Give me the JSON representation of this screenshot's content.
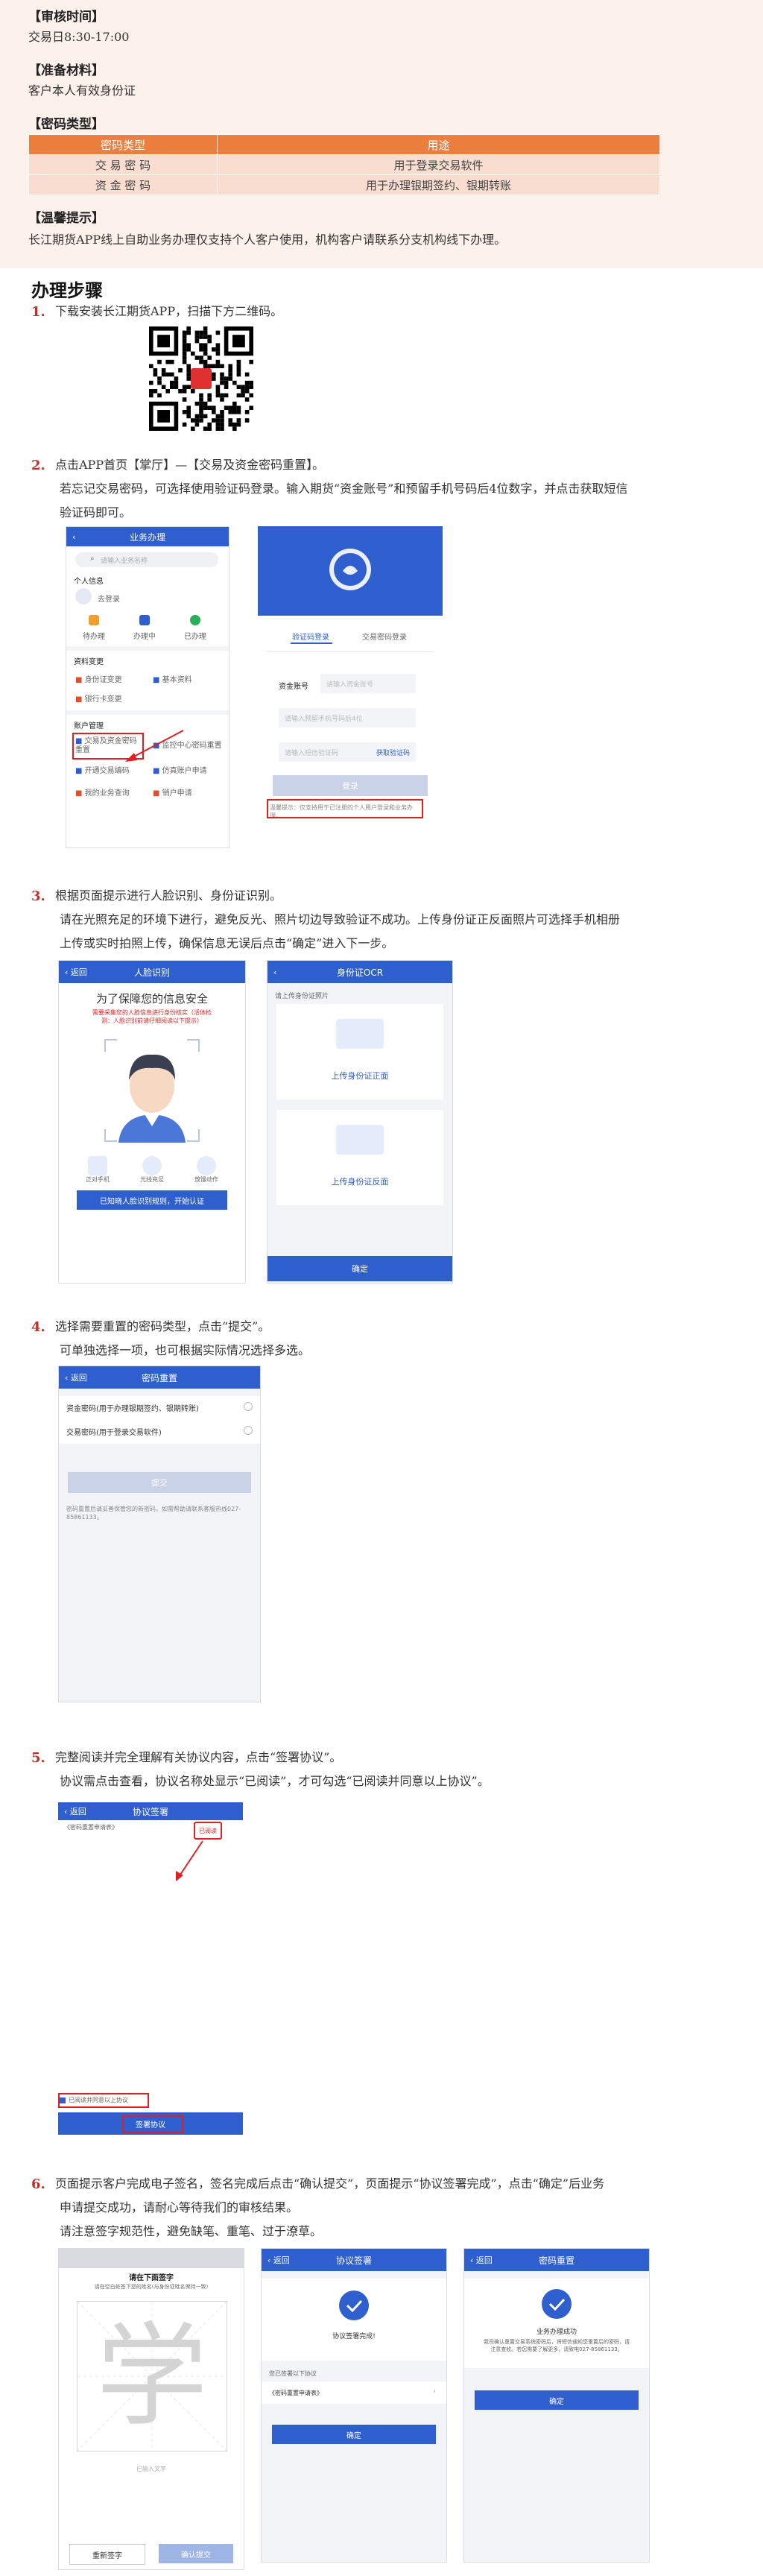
{
  "top": {
    "review_time_title": "【审核时间】",
    "review_time_text": "交易日8:30-17:00",
    "materials_title": "【准备材料】",
    "materials_text": "客户本人有效身份证",
    "pwd_type_title": "【密码类型】",
    "table_headers": [
      "密码类型",
      "用途"
    ],
    "table_rows": [
      [
        "交 易 密 码",
        "用于登录交易软件"
      ],
      [
        "资 金 密 码",
        "用于办理银期签约、银期转账"
      ]
    ],
    "tips_title": "【温馨提示】",
    "tips_text": "长江期货APP线上自助业务办理仅支持个人客户使用，机构客户请联系分支机构线下办理。"
  },
  "steps_title": "办理步骤",
  "steps": [
    {
      "num": "1.",
      "lines": [
        "下载安装长江期货APP，扫描下方二维码。"
      ]
    },
    {
      "num": "2.",
      "lines": [
        "点击APP首页【掌厅】—【交易及资金密码重置】。",
        "若忘记交易密码，可选择使用验证码登录。输入期货“资金账号”和预留手机号码后4位数字，并点击获取短信",
        "验证码即可。"
      ]
    },
    {
      "num": "3.",
      "lines": [
        "根据页面提示进行人脸识别、身份证识别。",
        "请在光照充足的环境下进行，避免反光、照片切边导致验证不成功。上传身份证正反面照片可选择手机相册",
        "上传或实时拍照上传，确保信息无误后点击“确定”进入下一步。"
      ]
    },
    {
      "num": "4.",
      "lines": [
        "选择需要重置的密码类型，点击“提交”。",
        "可单独选择一项，也可根据实际情况选择多选。"
      ]
    },
    {
      "num": "5.",
      "lines": [
        "完整阅读并完全理解有关协议内容，点击“签署协议”。",
        "协议需点击查看，协议名称处显示“已阅读”，才可勾选“已阅读并同意以上协议”。"
      ]
    },
    {
      "num": "6.",
      "lines": [
        "页面提示客户完成电子签名，签名完成后点击“确认提交”，页面提示“协议签署完成”，点击“确定”后业务",
        "申请提交成功，请耐心等待我们的审核结果。",
        "请注意签字规范性，避免缺笔、重笔、过于潦草。"
      ]
    }
  ],
  "s2": {
    "home_title": "业务办理",
    "search_placeholder": "请输入业务名称",
    "personal_info": "个人信息",
    "not_logged": "去登录",
    "todo": "待办理",
    "doing": "办理中",
    "done": "已办理",
    "info_change": "资料变更",
    "id_change": "身份证变更",
    "basic_info": "基本资料",
    "bank_card": "银行卡变更",
    "account_mgmt": "账户管理",
    "pwd_reset": "交易及资金密码重置",
    "monitor_pwd": "监控中心密码重置",
    "exchange_code": "开通交易编码",
    "optional_account": "仿真账户申请",
    "my_query": "我的业务查询",
    "cancel_account": "销户申请",
    "login_tab_code": "验证码登录",
    "login_tab_pwd": "交易密码登录",
    "fund_account_label": "资金账号",
    "fund_account_placeholder": "请输入资金账号",
    "phone_placeholder": "请输入预留手机号码后4位",
    "sms_placeholder": "请输入短信验证码",
    "get_code": "获取验证码",
    "login_btn": "登录",
    "notice": "温馨提示：仅支持用于已注册的个人用户登录和业务办理。"
  },
  "s3": {
    "face_title": "人脸识别",
    "face_heading": "为了保障您的信息安全",
    "face_warn": "需要采集您的人脸信息进行身份核实（活体检测：人脸识别前请仔细阅读以下提示）",
    "face_tips": [
      "正对手机",
      "光线充足",
      "放慢动作"
    ],
    "face_btn": "已知晓人脸识别规则，开始认证",
    "ocr_title": "身份证OCR",
    "ocr_hint": "请上传身份证照片",
    "ocr_front": "上传身份证正面",
    "ocr_back": "上传身份证反面",
    "ocr_btn": "确定"
  },
  "s4": {
    "title": "密码重置",
    "opt1": "资金密码(用于办理银期签约、银期转账)",
    "opt2": "交易密码(用于登录交易软件)",
    "submit": "提交",
    "note": "密码重置后请妥善保管您的新密码，如需帮助请联系客服热线027-85861133。"
  },
  "s5": {
    "title": "协议签署",
    "doc": "《密码重置申请表》",
    "read_badge": "已阅读",
    "agree": "已阅读并同意以上协议",
    "sign_btn": "签署协议"
  },
  "s6": {
    "sign_prompt": "请在下面签字",
    "sign_hint": "请在空白处签下您的姓名(与身份证姓名保持一致)",
    "char": "学",
    "sign_placeholder": "已输入文字",
    "resign_btn": "重新签字",
    "confirm_btn": "确认提交",
    "done_title": "协议签署",
    "done_text": "协议签署完成!",
    "done_docs_label": "您已签署以下协议",
    "done_doc": "《密码重置申请表》",
    "done_btn": "确定",
    "result_title": "密码重置",
    "result_heading": "业务办理成功",
    "result_text": "我司确认重置交易系统密码后，将短信通知您重置后的密码，请注意查收。若您需要了解更多，请致电027-85861133。",
    "result_btn": "确定"
  }
}
